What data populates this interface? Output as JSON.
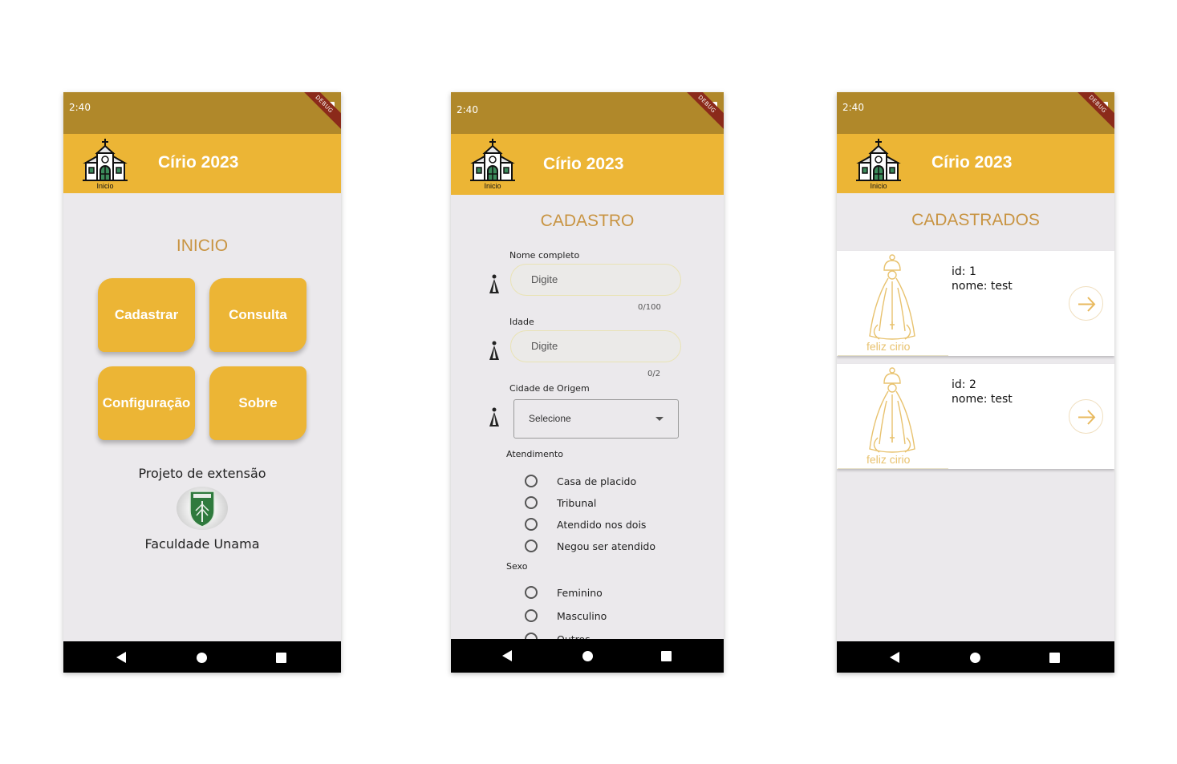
{
  "app": {
    "title": "Círio 2023",
    "logo_label": "Inicio",
    "debug_label": "DEBUG"
  },
  "home": {
    "time": "2:40",
    "heading": "INICIO",
    "buttons": [
      "Cadastrar",
      "Consulta",
      "Configuração",
      "Sobre"
    ],
    "project_label": "Projeto de extensão",
    "college_label": "Faculdade Unama"
  },
  "register": {
    "time": "2:40",
    "heading": "CADASTRO",
    "name_label": "Nome completo",
    "name_placeholder": "Digite",
    "name_counter": "0/100",
    "age_label": "Idade",
    "age_placeholder": "Digite",
    "age_counter": "0/2",
    "city_label": "Cidade de Origem",
    "city_value": "Selecione",
    "service_label": "Atendimento",
    "service_options": [
      "Casa de placido",
      "Tribunal",
      "Atendido nos dois",
      "Negou ser atendido"
    ],
    "sex_label": "Sexo",
    "sex_options": [
      "Feminino",
      "Masculino",
      "Outros"
    ]
  },
  "registered": {
    "time": "2:40",
    "heading": "CADASTRADOS",
    "image_caption": "feliz cirio",
    "items": [
      {
        "id": "id: 1",
        "name": "nome: test"
      },
      {
        "id": "id: 2",
        "name": "nome: test"
      }
    ]
  },
  "colors": {
    "status_bar": "#b0882a",
    "app_bar": "#ecb535",
    "heading": "#c89442",
    "background": "#ebe9ec"
  }
}
